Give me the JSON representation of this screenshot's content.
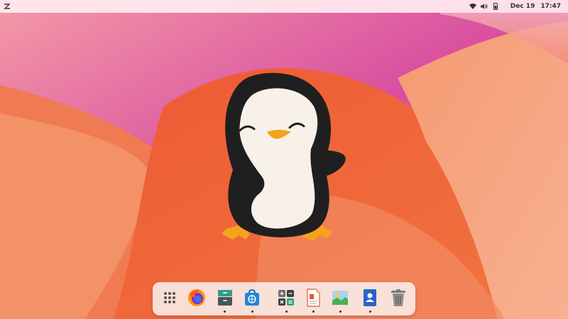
{
  "topbar": {
    "date": "Dec 19",
    "time": "17:47",
    "tray_icons": [
      "wifi-icon",
      "volume-icon",
      "battery-icon"
    ]
  },
  "dock": {
    "apps": [
      {
        "name": "app-grid",
        "icon": "app-grid-icon",
        "running": false
      },
      {
        "name": "firefox",
        "icon": "firefox-icon",
        "running": false
      },
      {
        "name": "files",
        "icon": "file-cabinet-icon",
        "running": true
      },
      {
        "name": "software",
        "icon": "software-store-icon",
        "running": true
      },
      {
        "name": "calculator",
        "icon": "calculator-icon",
        "running": true
      },
      {
        "name": "document",
        "icon": "document-icon",
        "running": true
      },
      {
        "name": "image-viewer",
        "icon": "image-viewer-icon",
        "running": true
      },
      {
        "name": "contacts",
        "icon": "contacts-icon",
        "running": true
      },
      {
        "name": "trash",
        "icon": "trash-icon",
        "running": false
      }
    ]
  },
  "colors": {
    "accent": "#e85a30",
    "penguin_black": "#1f1f1f",
    "penguin_belly": "#f7f1ea",
    "penguin_feet": "#f6a31c"
  }
}
